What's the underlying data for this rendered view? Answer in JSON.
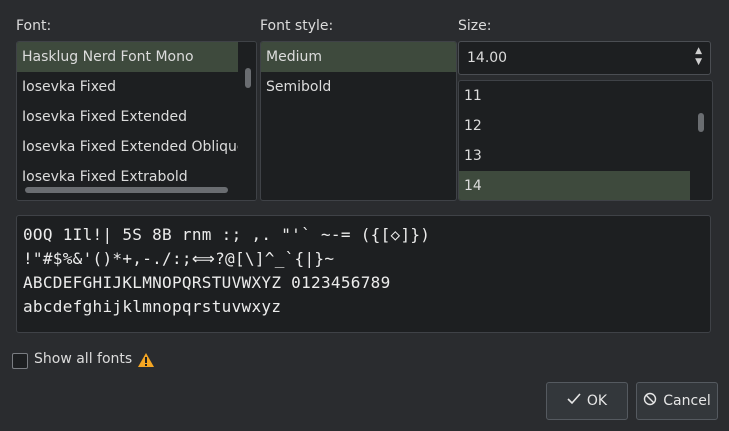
{
  "labels": {
    "font": "Font:",
    "style": "Font style:",
    "size": "Size:"
  },
  "font_list": [
    "Hasklug Nerd Font Mono",
    "Iosevka Fixed",
    "Iosevka Fixed Extended",
    "Iosevka Fixed Extended Oblique",
    "Iosevka Fixed Extrabold"
  ],
  "style_list": [
    "Medium",
    "Semibold"
  ],
  "size_value": "14.00",
  "size_list": [
    "11",
    "12",
    "13",
    "14"
  ],
  "preview_lines": [
    "0OQ 1Il!| 5S 8B rnm :; ,. \"'` ~-= ({[◇]})",
    "!\"#$%&'()*+,-./:;⟺?@[\\]^_`{|}~",
    "ABCDEFGHIJKLMNOPQRSTUVWXYZ 0123456789",
    "abcdefghijklmnopqrstuvwxyz"
  ],
  "show_all_fonts": "Show all fonts",
  "buttons": {
    "ok": "OK",
    "cancel": "Cancel"
  },
  "colors": {
    "selection": "#3e4a3d",
    "warning": "#f5a623"
  }
}
